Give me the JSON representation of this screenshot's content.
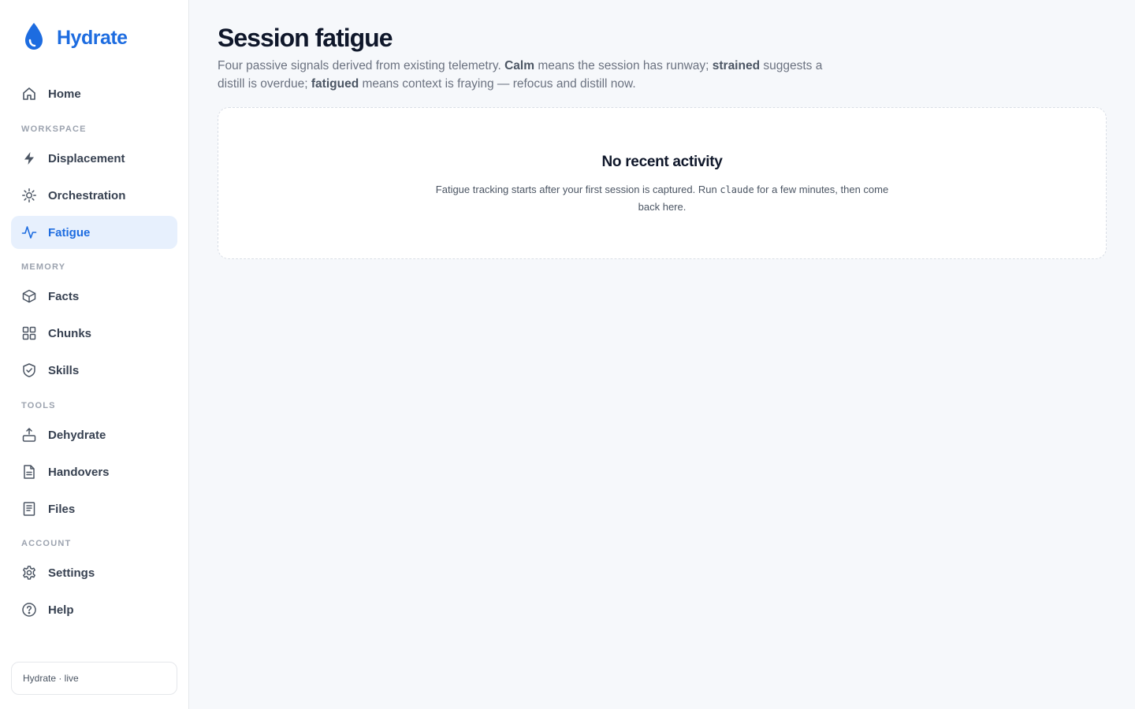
{
  "app": {
    "brand": "Hydrate",
    "accent_color": "#1d6ce0"
  },
  "sidebar": {
    "home": {
      "label": "Home",
      "icon": "home-icon"
    },
    "sections": {
      "workspace": "WORKSPACE",
      "memory": "MEMORY",
      "tools": "TOOLS",
      "account": "ACCOUNT"
    },
    "items": {
      "displacement": {
        "label": "Displacement",
        "icon": "bolt-icon"
      },
      "orchestration": {
        "label": "Orchestration",
        "icon": "sun-icon"
      },
      "fatigue": {
        "label": "Fatigue",
        "icon": "pulse-icon",
        "active": true
      },
      "facts": {
        "label": "Facts",
        "icon": "box-icon"
      },
      "chunks": {
        "label": "Chunks",
        "icon": "grid-icon"
      },
      "skills": {
        "label": "Skills",
        "icon": "shield-check-icon"
      },
      "dehydrate": {
        "label": "Dehydrate",
        "icon": "upload-tray-icon"
      },
      "handovers": {
        "label": "Handovers",
        "icon": "document-icon"
      },
      "files": {
        "label": "Files",
        "icon": "notebook-icon"
      },
      "settings": {
        "label": "Settings",
        "icon": "gear-icon"
      },
      "help": {
        "label": "Help",
        "icon": "question-circle-icon"
      }
    },
    "status": "Hydrate · live"
  },
  "main": {
    "title": "Session fatigue",
    "description": {
      "part1": "Four passive signals derived from existing telemetry. ",
      "calm": "Calm",
      "part2": " means the session has runway; ",
      "strained": "strained",
      "part3": " suggests a distill is overdue; ",
      "fatigued": "fatigued",
      "part4": " means context is fraying — refocus and distill now."
    },
    "empty_state": {
      "title": "No recent activity",
      "text_before": "Fatigue tracking starts after your first session is captured. Run ",
      "code": "claude",
      "text_after": " for a few minutes, then come back here."
    }
  }
}
